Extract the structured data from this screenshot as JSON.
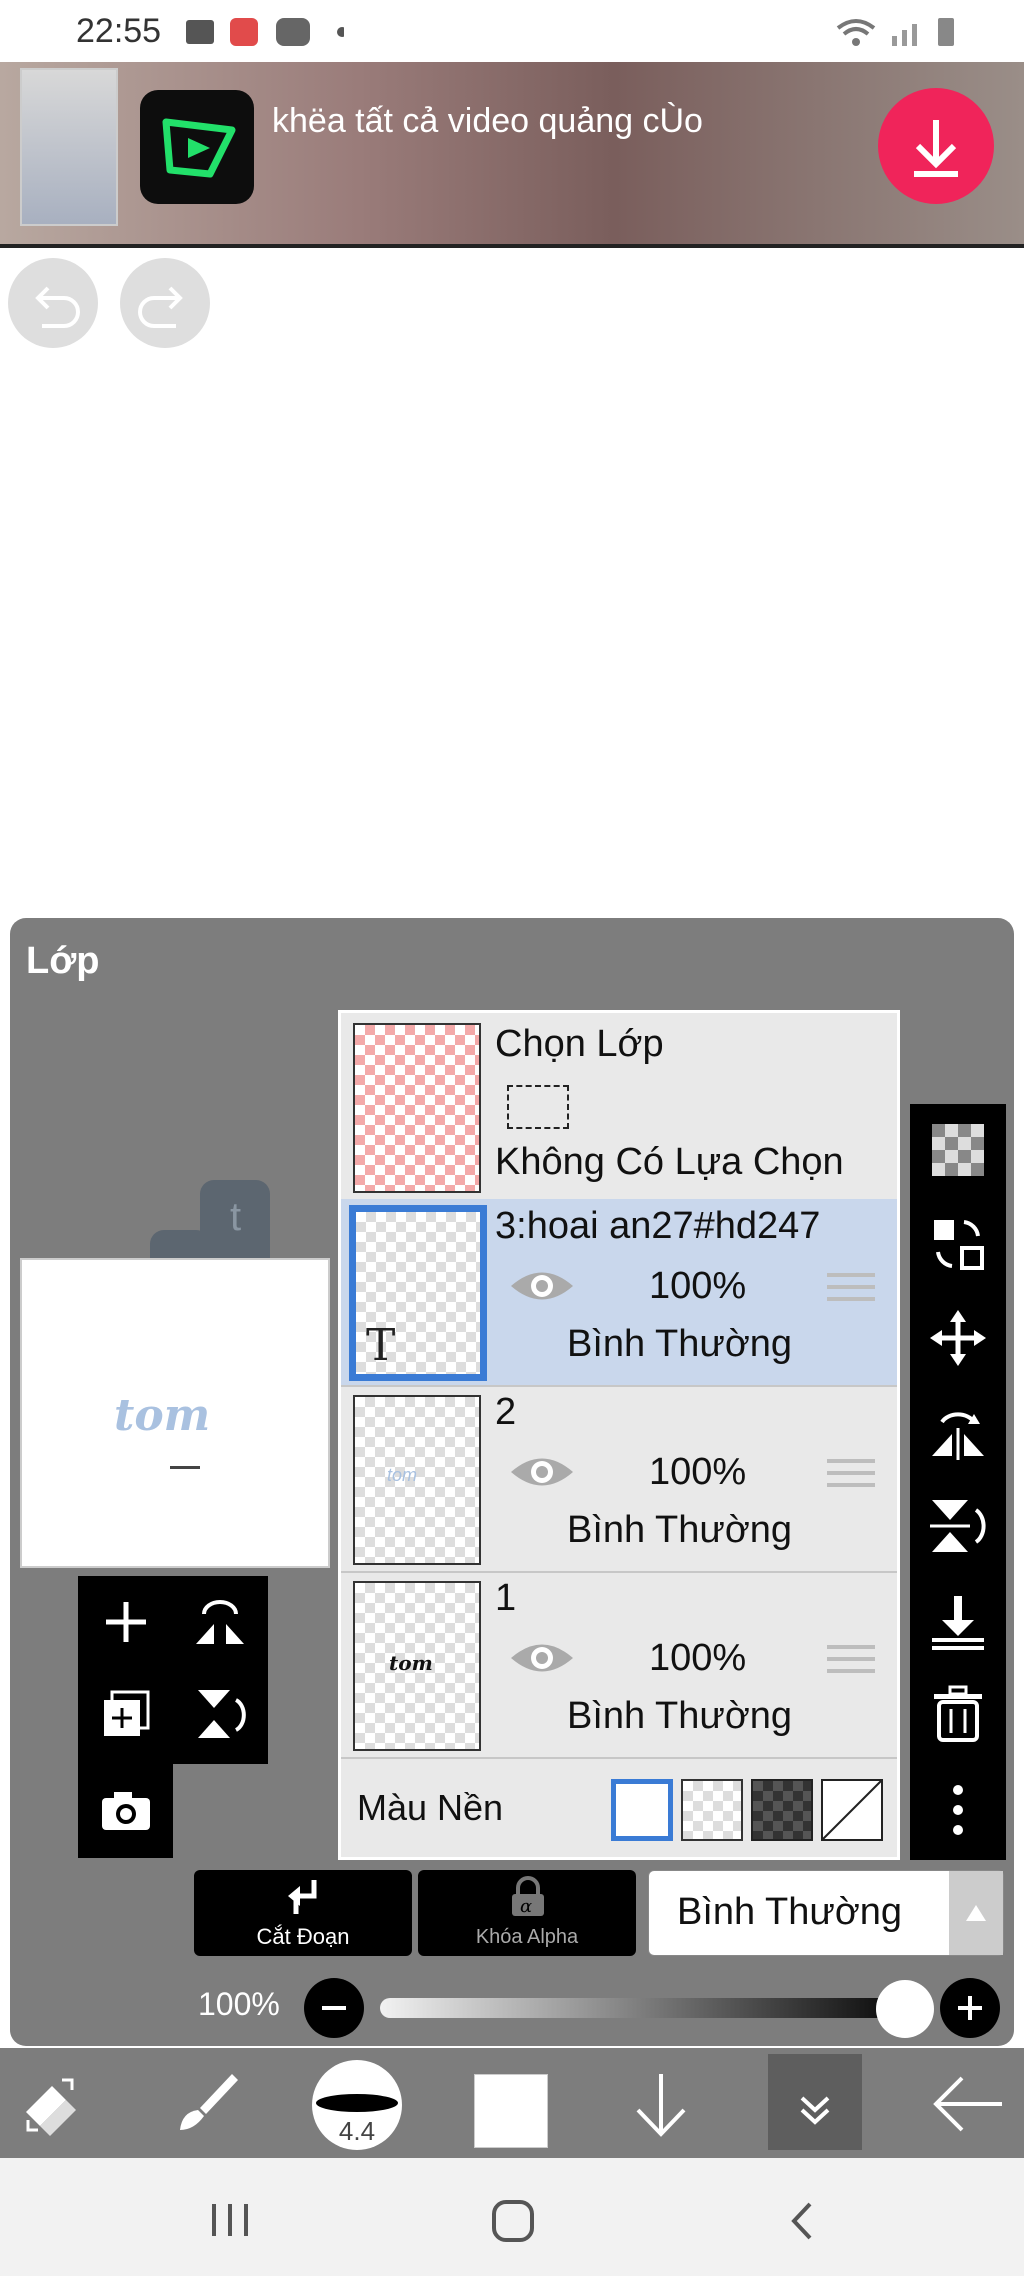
{
  "status_bar": {
    "time": "22:55"
  },
  "ad_banner": {
    "text": "khëa tất cả video quảng cÙo"
  },
  "layer_panel": {
    "title": "Lớp",
    "selection_layer": {
      "title": "Chọn Lớp",
      "status": "Không Có Lựa Chọn"
    },
    "layers": [
      {
        "name": "3:hoai an27#hd247",
        "opacity": "100%",
        "blend": "Bình Thường",
        "selected": true,
        "thumb_glyph": "T"
      },
      {
        "name": "2",
        "opacity": "100%",
        "blend": "Bình Thường",
        "selected": false,
        "thumb_text": "tom"
      },
      {
        "name": "1",
        "opacity": "100%",
        "blend": "Bình Thường",
        "selected": false,
        "thumb_text": "tom"
      }
    ],
    "background": {
      "label": "Màu Nền"
    },
    "canvas_preview_text": "tom",
    "clip_label": "Cắt Đoạn",
    "alpha_lock_label": "Khóa Alpha",
    "blend_mode": "Bình Thường",
    "opacity_value": "100%"
  },
  "toolbar": {
    "brush_size": "4.4"
  },
  "colors": {
    "panel_bg": "#7d7d7d",
    "selected_row": "#c9d7ec",
    "selected_border": "#3a7bd5",
    "ad_download": "#f0245a"
  }
}
